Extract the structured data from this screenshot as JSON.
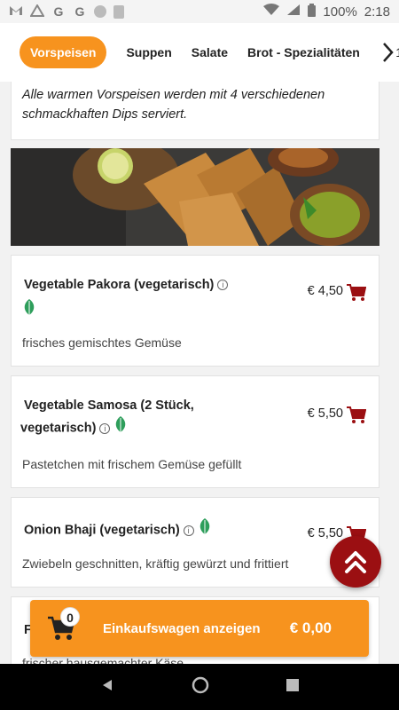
{
  "status_bar": {
    "icons": [
      "gmail-icon",
      "triangle-icon",
      "google-icon",
      "google-icon",
      "circle-icon",
      "sd-card-icon"
    ],
    "battery": "100%",
    "time": "2:18"
  },
  "categories": [
    {
      "label": "Vorspeisen",
      "active": true
    },
    {
      "label": "Suppen",
      "active": false
    },
    {
      "label": "Salate",
      "active": false
    },
    {
      "label": "Brot - Spezialitäten",
      "active": false
    }
  ],
  "category_overflow": "1",
  "intro_text": "Alle warmen Vorspeisen werden mit 4 verschiedenen schmackhaften Dips serviert.",
  "items": [
    {
      "title": "Vegetable Pakora (vegetarisch)",
      "price": "€ 4,50",
      "description": "frisches gemischtes Gemüse"
    },
    {
      "title_line1": "Vegetable Samosa (2 Stück,",
      "title_line2": "vegetarisch)",
      "price": "€ 5,50",
      "description": "Pastetchen mit frischem Gemüse gefüllt"
    },
    {
      "title": "Onion Bhaji (vegetarisch)",
      "price": "€ 5,50",
      "description": "Zwiebeln geschnitten, kräftig gewürzt und frittiert"
    },
    {
      "title": "F",
      "description": "frischer hausgemachter Käse"
    }
  ],
  "cart": {
    "count": "0",
    "label": "Einkaufswagen anzeigen",
    "total": "€ 0,00"
  },
  "colors": {
    "accent": "#f7931e",
    "cart_icon": "#9b0f12",
    "leaf": "#2e9e5b",
    "fab": "#9b0f12"
  }
}
